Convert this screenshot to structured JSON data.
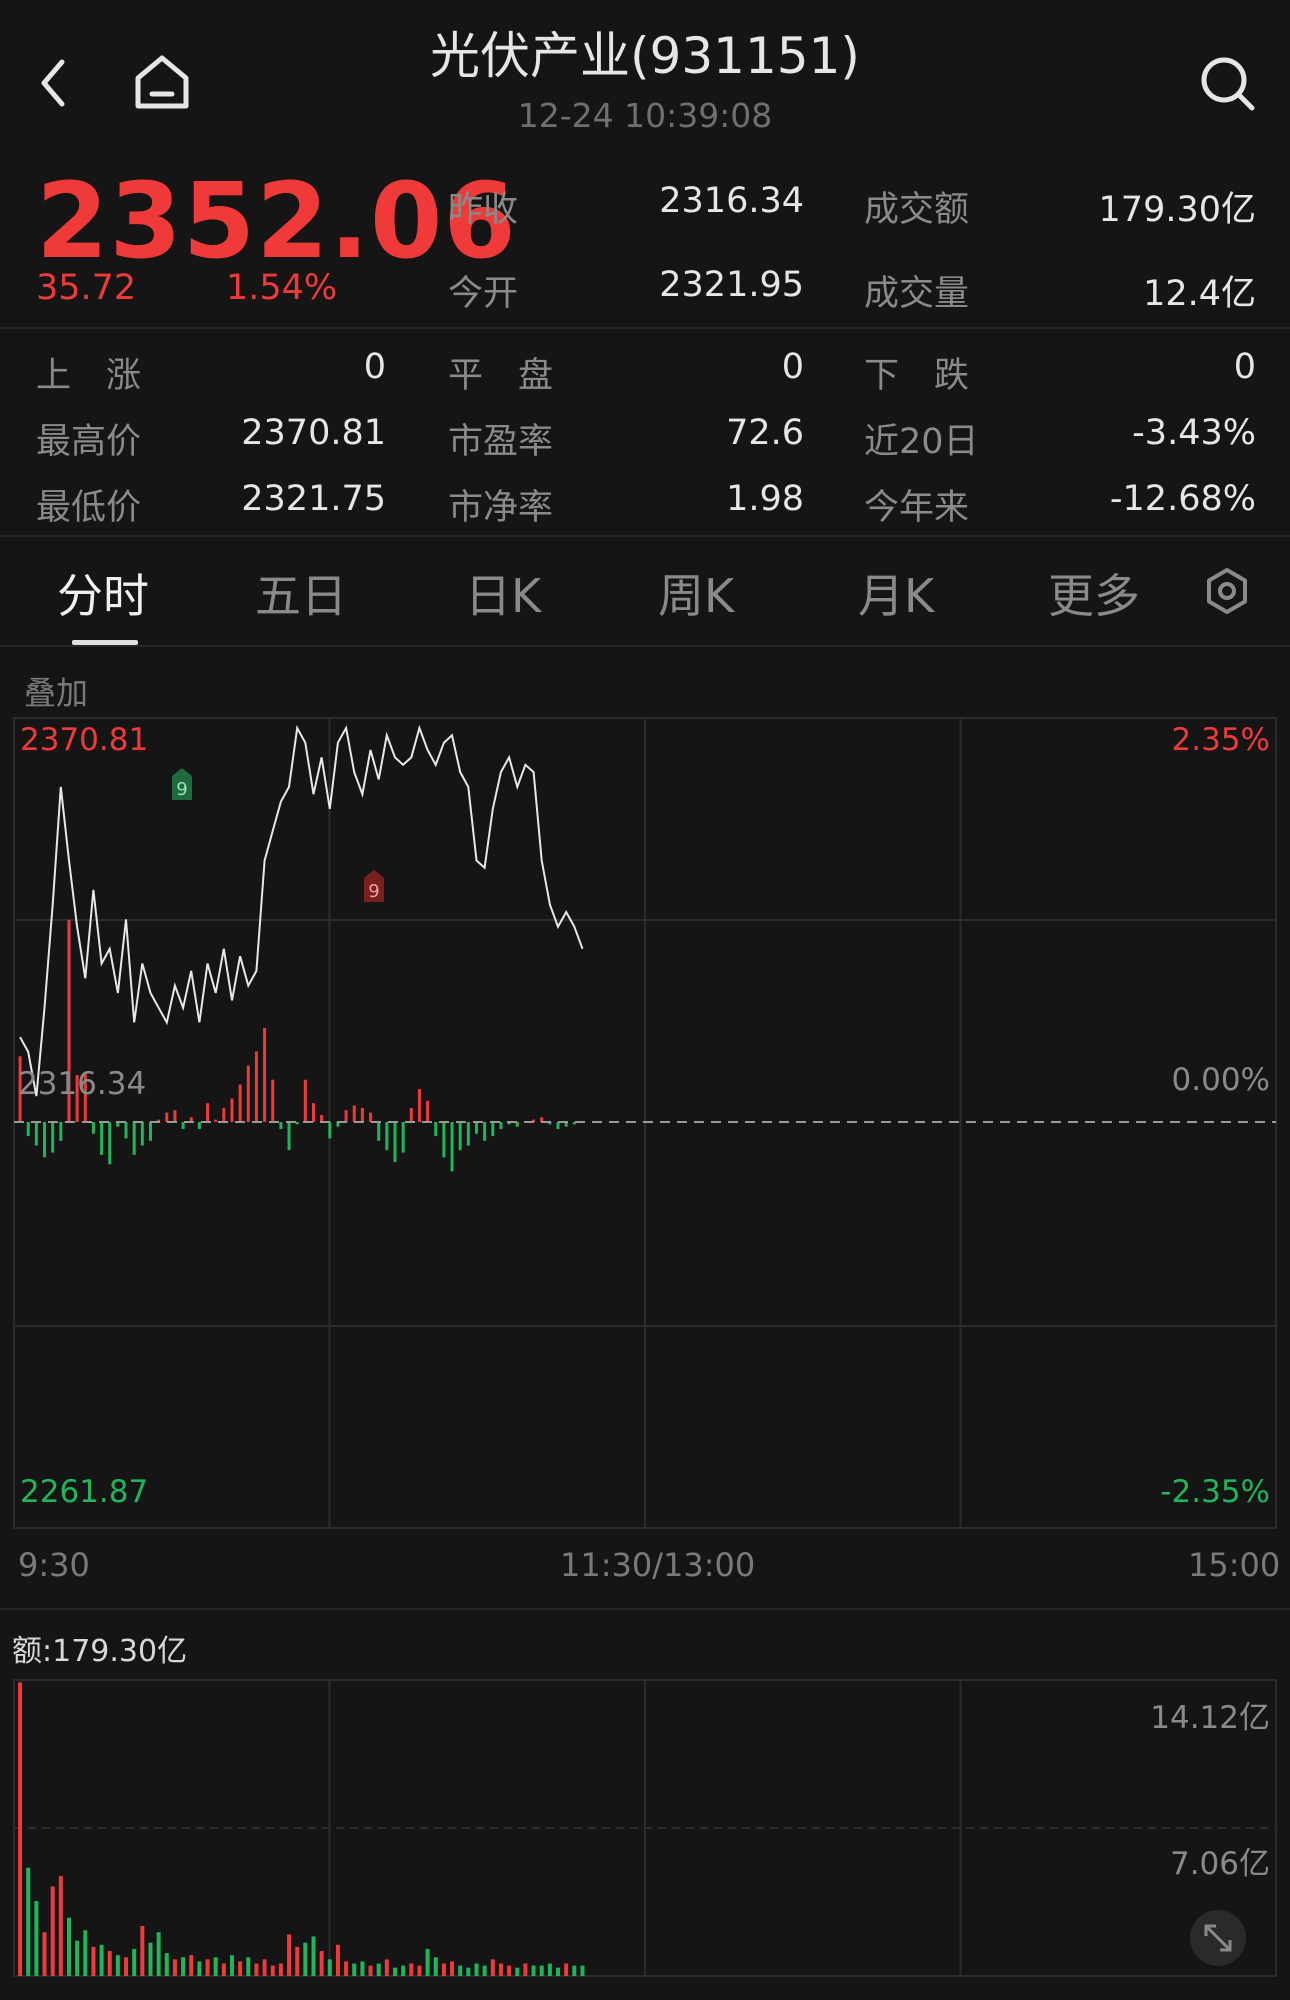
{
  "header": {
    "title": "光伏产业(931151)",
    "time": "12-24 10:39:08",
    "back_icon": "chevron-left-icon",
    "home_icon": "home-icon",
    "search_icon": "search-icon"
  },
  "quote": {
    "price": "2352.06",
    "change": "35.72",
    "change_pct": "1.54%",
    "stats_top": [
      {
        "label": "昨收",
        "value": "2316.34"
      },
      {
        "label": "成交额",
        "value": "179.30亿"
      },
      {
        "label": "今开",
        "value": "2321.95"
      },
      {
        "label": "成交量",
        "value": "12.4亿"
      }
    ],
    "stats_grid": [
      {
        "label": "上　涨",
        "value": "0"
      },
      {
        "label": "平　盘",
        "value": "0"
      },
      {
        "label": "下　跌",
        "value": "0"
      },
      {
        "label": "最高价",
        "value": "2370.81"
      },
      {
        "label": "市盈率",
        "value": "72.6"
      },
      {
        "label": "近20日",
        "value": "-3.43%"
      },
      {
        "label": "最低价",
        "value": "2321.75"
      },
      {
        "label": "市净率",
        "value": "1.98"
      },
      {
        "label": "今年来",
        "value": "-12.68%"
      }
    ]
  },
  "tabs": [
    "分时",
    "五日",
    "日K",
    "周K",
    "月K",
    "更多"
  ],
  "tab_selected": "分时",
  "settings_icon": "settings-hexagon-icon",
  "overlay_label": "叠加",
  "intraday": {
    "high_label": "2370.81",
    "base_label": "2316.34",
    "low_label": "2261.87",
    "pct_high": "2.35%",
    "pct_base": "0.00%",
    "pct_low": "-2.35%",
    "time_start": "9:30",
    "time_mid": "11:30/13:00",
    "time_end": "15:00",
    "marker_top": "9",
    "marker_bottom": "9"
  },
  "turnover": {
    "label": "额:179.30亿",
    "max_label": "14.12亿",
    "mid_label": "7.06亿",
    "expand_icon": "expand-arrows-icon"
  },
  "colors": {
    "up": "#f03a3a",
    "down": "#1fb65a",
    "line": "#e8e8e8",
    "grid": "#2c2c2c"
  },
  "chart_data": {
    "type": "line",
    "title": "",
    "ylim": [
      2261.87,
      2370.81
    ],
    "prev_close": 2316.34,
    "x": [
      0,
      1,
      2,
      3,
      4,
      5,
      6,
      7,
      8,
      9,
      10,
      11,
      12,
      13,
      14,
      15,
      16,
      17,
      18,
      19,
      20,
      21,
      22,
      23,
      24,
      25,
      26,
      27,
      28,
      29,
      30,
      31,
      32,
      33,
      34,
      35,
      36,
      37,
      38,
      39,
      40,
      41,
      42,
      43,
      44,
      45,
      46,
      47,
      48,
      49,
      50,
      51,
      52,
      53,
      54,
      55,
      56,
      57,
      58,
      59,
      60,
      61,
      62,
      63,
      64,
      65,
      66,
      67,
      68,
      69
    ],
    "price": [
      2328,
      2326,
      2320,
      2332,
      2346,
      2362,
      2352,
      2343,
      2336,
      2348,
      2338,
      2340,
      2334,
      2344,
      2330,
      2338,
      2334,
      2332,
      2330,
      2335,
      2332,
      2337,
      2330,
      2338,
      2334,
      2340,
      2333,
      2339,
      2335,
      2337,
      2352,
      2356,
      2360,
      2362,
      2370,
      2368,
      2361,
      2366,
      2359,
      2368,
      2370,
      2364,
      2361,
      2367,
      2363,
      2369,
      2366,
      2365,
      2366,
      2370,
      2367,
      2365,
      2368,
      2369,
      2364,
      2362,
      2352,
      2351,
      2359,
      2364,
      2366,
      2362,
      2365,
      2364,
      2352,
      2346,
      2343,
      2345,
      2343,
      2340
    ],
    "momentum": [
      28,
      -6,
      -10,
      -15,
      -13,
      -8,
      86,
      20,
      21,
      -5,
      -14,
      -18,
      -2,
      -7,
      -14,
      -10,
      -8,
      1,
      4,
      5,
      -3,
      2,
      -3,
      8,
      1,
      6,
      10,
      16,
      24,
      30,
      40,
      18,
      -3,
      -12,
      -1,
      18,
      8,
      3,
      -7,
      -2,
      5,
      7,
      6,
      4,
      -8,
      -12,
      -17,
      -13,
      6,
      14,
      9,
      -6,
      -15,
      -21,
      -12,
      -10,
      -5,
      -8,
      -6,
      -3,
      -1,
      -2,
      0,
      1,
      2,
      -1,
      -3,
      -2,
      -1,
      0
    ],
    "turnover_yi": [
      14.1,
      5.2,
      3.6,
      2.1,
      4.3,
      4.8,
      2.8,
      1.7,
      2.2,
      1.4,
      1.5,
      1.2,
      1.0,
      0.9,
      1.3,
      2.4,
      1.6,
      2.1,
      1.1,
      0.8,
      0.9,
      1.0,
      0.7,
      0.8,
      0.9,
      0.6,
      1.0,
      0.7,
      0.9,
      0.6,
      0.8,
      0.5,
      0.6,
      2.0,
      1.4,
      1.6,
      1.9,
      1.2,
      0.8,
      1.5,
      0.7,
      0.6,
      0.7,
      0.5,
      0.6,
      0.8,
      0.4,
      0.5,
      0.6,
      0.5,
      1.3,
      0.9,
      0.6,
      0.7,
      0.5,
      0.4,
      0.6,
      0.5,
      0.8,
      0.6,
      0.5,
      0.4,
      0.6,
      0.5,
      0.5,
      0.6,
      0.4,
      0.6,
      0.5,
      0.5
    ]
  }
}
